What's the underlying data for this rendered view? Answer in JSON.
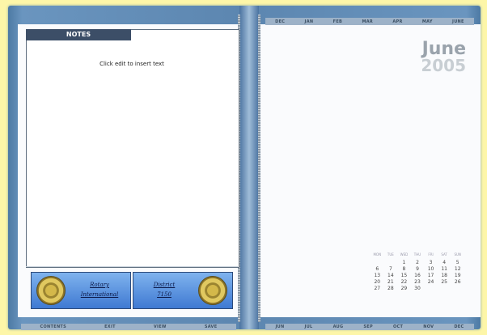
{
  "notes": {
    "title": "NOTES",
    "placeholder": "Click edit to insert text"
  },
  "banners": [
    {
      "label_line1": "Rotary",
      "label_line2": "International"
    },
    {
      "label_line1": "District",
      "label_line2": "7150"
    }
  ],
  "bottom_left_nav": [
    "CONTENTS",
    "EXIT",
    "VIEW",
    "SAVE"
  ],
  "top_months": [
    "DEC",
    "JAN",
    "FEB",
    "MAR",
    "APR",
    "MAY",
    "JUNE"
  ],
  "bottom_months": [
    "JUN",
    "JUL",
    "AUG",
    "SEP",
    "OCT",
    "NOV",
    "DEC"
  ],
  "calendar": {
    "month": "June",
    "year": "2005",
    "weekdays": [
      "MON",
      "TUE",
      "WED",
      "THU",
      "FRI",
      "SAT",
      "SUN"
    ],
    "leading_blanks": 2,
    "days": [
      "1",
      "2",
      "3",
      "4",
      "5",
      "6",
      "7",
      "8",
      "9",
      "10",
      "11",
      "12",
      "13",
      "14",
      "15",
      "16",
      "17",
      "18",
      "19",
      "20",
      "21",
      "22",
      "23",
      "24",
      "25",
      "26",
      "27",
      "28",
      "29",
      "30"
    ]
  },
  "colors": {
    "background": "#fdf6a8",
    "book_blue": "#5c86b0",
    "notes_tab": "#3c4e67",
    "banner_blue": "#3f79d2"
  }
}
